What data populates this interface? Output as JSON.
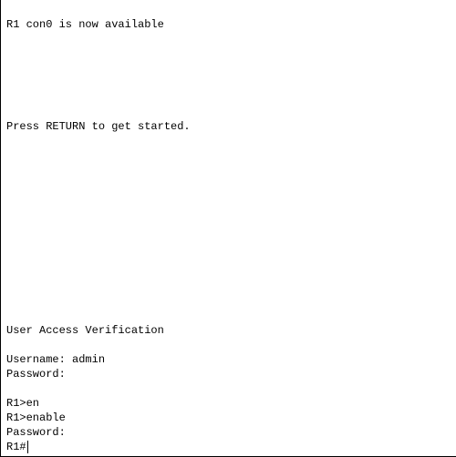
{
  "terminal": {
    "line_console_available": "R1 con0 is now available",
    "line_press_return": "Press RETURN to get started.",
    "line_user_access": "User Access Verification",
    "line_username": "Username: admin",
    "line_password_1": "Password:",
    "line_cmd_en": "R1>en",
    "line_cmd_enable": "R1>enable",
    "line_password_2": "Password:",
    "prompt_current": "R1#"
  }
}
